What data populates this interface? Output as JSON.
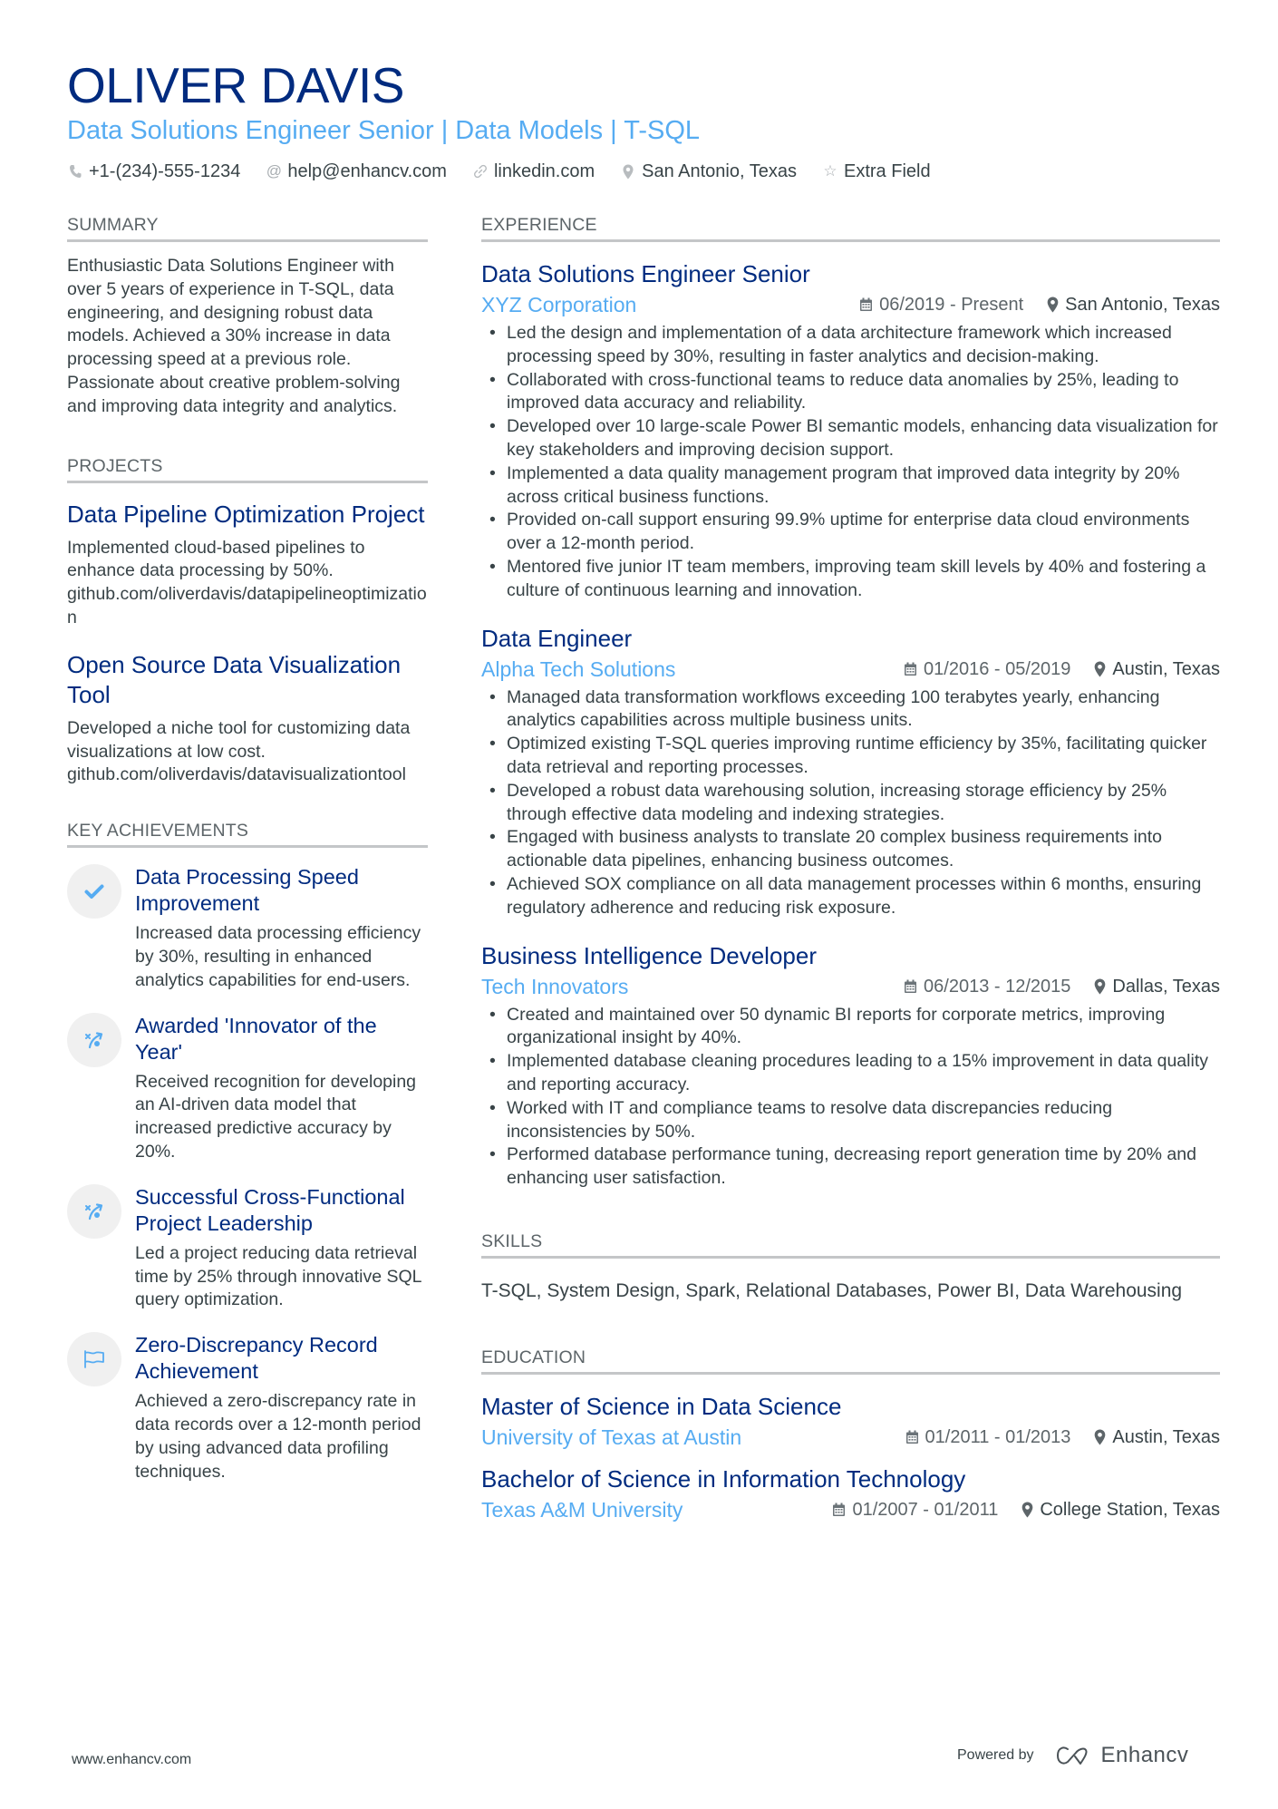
{
  "header": {
    "name": "OLIVER DAVIS",
    "subtitle": "Data Solutions Engineer Senior | Data Models | T-SQL",
    "contacts": [
      {
        "icon": "phone-icon",
        "text": "+1-(234)-555-1234"
      },
      {
        "icon": "at-icon",
        "text": "help@enhancv.com"
      },
      {
        "icon": "link-icon",
        "text": "linkedin.com"
      },
      {
        "icon": "location-icon",
        "text": "San Antonio, Texas"
      },
      {
        "icon": "star-icon",
        "text": "Extra Field"
      }
    ]
  },
  "summary": {
    "title": "SUMMARY",
    "text": "Enthusiastic Data Solutions Engineer with over 5 years of experience in T-SQL, data engineering, and designing robust data models. Achieved a 30% increase in data processing speed at a previous role. Passionate about creative problem-solving and improving data integrity and analytics."
  },
  "projects": {
    "title": "PROJECTS",
    "items": [
      {
        "title": "Data Pipeline Optimization Project",
        "description": "Implemented cloud-based pipelines to enhance data processing by 50%.",
        "link": "github.com/oliverdavis/datapipelineoptimization"
      },
      {
        "title": "Open Source Data Visualization Tool",
        "description": "Developed a niche tool for customizing data visualizations at low cost.",
        "link": "github.com/oliverdavis/datavisualizationtool"
      }
    ]
  },
  "achievements": {
    "title": "KEY ACHIEVEMENTS",
    "items": [
      {
        "icon": "checkmark-icon",
        "title": "Data Processing Speed Improvement",
        "description": "Increased data processing efficiency by 30%, resulting in enhanced analytics capabilities for end-users."
      },
      {
        "icon": "strategy-icon",
        "title": "Awarded 'Innovator of the Year'",
        "description": "Received recognition for developing an AI-driven data model that increased predictive accuracy by 20%."
      },
      {
        "icon": "strategy-icon",
        "title": "Successful Cross-Functional Project Leadership",
        "description": "Led a project reducing data retrieval time by 25% through innovative SQL query optimization."
      },
      {
        "icon": "flag-icon",
        "title": "Zero-Discrepancy Record Achievement",
        "description": "Achieved a zero-discrepancy rate in data records over a 12-month period by using advanced data profiling techniques."
      }
    ]
  },
  "experience": {
    "title": "EXPERIENCE",
    "items": [
      {
        "role": "Data Solutions Engineer Senior",
        "company": "XYZ Corporation",
        "dates": "06/2019 - Present",
        "location": "San Antonio, Texas",
        "bullets": [
          "Led the design and implementation of a data architecture framework which increased processing speed by 30%, resulting in faster analytics and decision-making.",
          "Collaborated with cross-functional teams to reduce data anomalies by 25%, leading to improved data accuracy and reliability.",
          "Developed over 10 large-scale Power BI semantic models, enhancing data visualization for key stakeholders and improving decision support.",
          "Implemented a data quality management program that improved data integrity by 20% across critical business functions.",
          "Provided on-call support ensuring 99.9% uptime for enterprise data cloud environments over a 12-month period.",
          "Mentored five junior IT team members, improving team skill levels by 40% and fostering a culture of continuous learning and innovation."
        ]
      },
      {
        "role": "Data Engineer",
        "company": "Alpha Tech Solutions",
        "dates": "01/2016 - 05/2019",
        "location": "Austin, Texas",
        "bullets": [
          "Managed data transformation workflows exceeding 100 terabytes yearly, enhancing analytics capabilities across multiple business units.",
          "Optimized existing T-SQL queries improving runtime efficiency by 35%, facilitating quicker data retrieval and reporting processes.",
          "Developed a robust data warehousing solution, increasing storage efficiency by 25% through effective data modeling and indexing strategies.",
          "Engaged with business analysts to translate 20 complex business requirements into actionable data pipelines, enhancing business outcomes.",
          "Achieved SOX compliance on all data management processes within 6 months, ensuring regulatory adherence and reducing risk exposure."
        ]
      },
      {
        "role": "Business Intelligence Developer",
        "company": "Tech Innovators",
        "dates": "06/2013 - 12/2015",
        "location": "Dallas, Texas",
        "bullets": [
          "Created and maintained over 50 dynamic BI reports for corporate metrics, improving organizational insight by 40%.",
          "Implemented database cleaning procedures leading to a 15% improvement in data quality and reporting accuracy.",
          "Worked with IT and compliance teams to resolve data discrepancies reducing inconsistencies by 50%.",
          "Performed database performance tuning, decreasing report generation time by 20% and enhancing user satisfaction."
        ]
      }
    ]
  },
  "skills": {
    "title": "SKILLS",
    "text": "T-SQL, System Design, Spark, Relational Databases, Power BI, Data Warehousing"
  },
  "education": {
    "title": "EDUCATION",
    "items": [
      {
        "degree": "Master of Science in Data Science",
        "school": "University of Texas at Austin",
        "dates": "01/2011 - 01/2013",
        "location": "Austin, Texas"
      },
      {
        "degree": "Bachelor of Science in Information Technology",
        "school": "Texas A&M University",
        "dates": "01/2007 - 01/2011",
        "location": "College Station, Texas"
      }
    ]
  },
  "footer": {
    "website": "www.enhancv.com",
    "powered_by": "Powered by",
    "brand": "Enhancv"
  },
  "colors": {
    "name": "#002b7f",
    "accent": "#56acf2",
    "text": "#384347",
    "rule": "#c4c6c8",
    "icon_bg": "#f0f0f0"
  }
}
